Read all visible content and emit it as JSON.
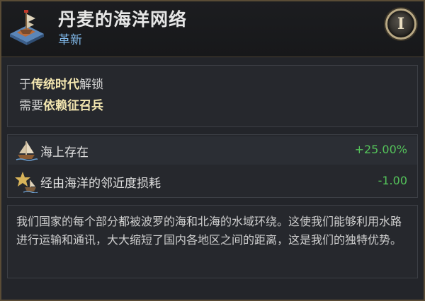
{
  "header": {
    "title": "丹麦的海洋网络",
    "subtitle": "革新",
    "era_badge": "I",
    "emblem_icon": "ship-harbor-icon"
  },
  "unlock": {
    "line1_prefix": "于",
    "line1_highlight": "传统时代",
    "line1_suffix": "解锁",
    "line2_prefix": "需要",
    "line2_highlight": "依赖征召兵"
  },
  "effects": [
    {
      "icon": "sailboat-icon",
      "label": "海上存在",
      "value": "+25.00%"
    },
    {
      "icon": "star-ship-icon",
      "label": "经由海洋的邻近度损耗",
      "value": "-1.00"
    }
  ],
  "description": "我们国家的每个部分都被波罗的海和北海的水域环绕。这使我们能够利用水路进行运输和通讯，大大缩短了国内各地区之间的距离，这是我们的独特优势。",
  "colors": {
    "title": "#e6e6e6",
    "subtitle": "#7fb7e8",
    "highlight": "#f3e6b0",
    "positive_value": "#54c35a",
    "border_gold": "#5a4c36"
  }
}
